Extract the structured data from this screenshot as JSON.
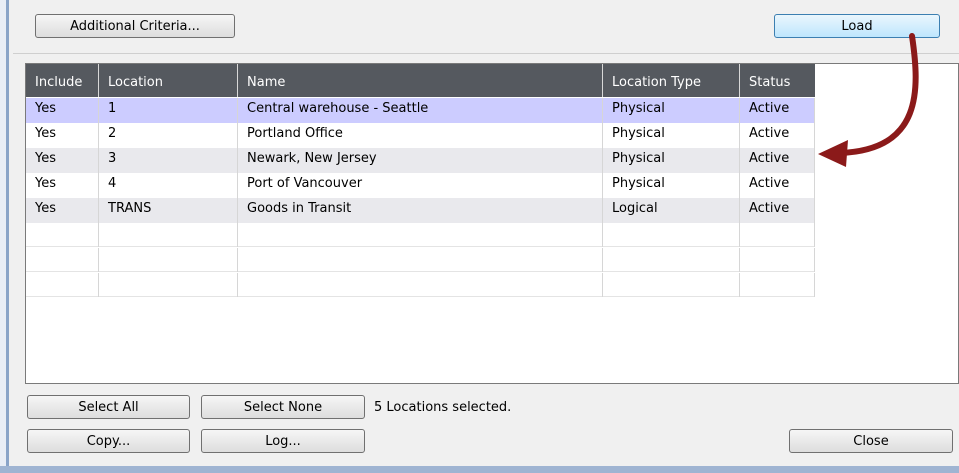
{
  "toolbar": {
    "additional_criteria_label": "Additional Criteria...",
    "load_label": "Load"
  },
  "grid": {
    "columns": [
      "Include",
      "Location",
      "Name",
      "Location Type",
      "Status"
    ],
    "rows": [
      [
        "Yes",
        "1",
        "Central warehouse - Seattle",
        "Physical",
        "Active"
      ],
      [
        "Yes",
        "2",
        "Portland Office",
        "Physical",
        "Active"
      ],
      [
        "Yes",
        "3",
        "Newark, New Jersey",
        "Physical",
        "Active"
      ],
      [
        "Yes",
        "4",
        "Port of Vancouver",
        "Physical",
        "Active"
      ],
      [
        "Yes",
        "TRANS",
        "Goods in Transit",
        "Logical",
        "Active"
      ]
    ],
    "selected_row": 0
  },
  "footer": {
    "select_all_label": "Select All",
    "select_none_label": "Select None",
    "selection_status": "5 Locations selected.",
    "copy_label": "Copy...",
    "log_label": "Log...",
    "close_label": "Close"
  },
  "colors": {
    "header_bg": "#55595f",
    "selected_row_bg": "#ccccff",
    "annotation_arrow": "#8b1a1a"
  },
  "icons": {
    "annotation": "curved-arrow-annotation"
  }
}
